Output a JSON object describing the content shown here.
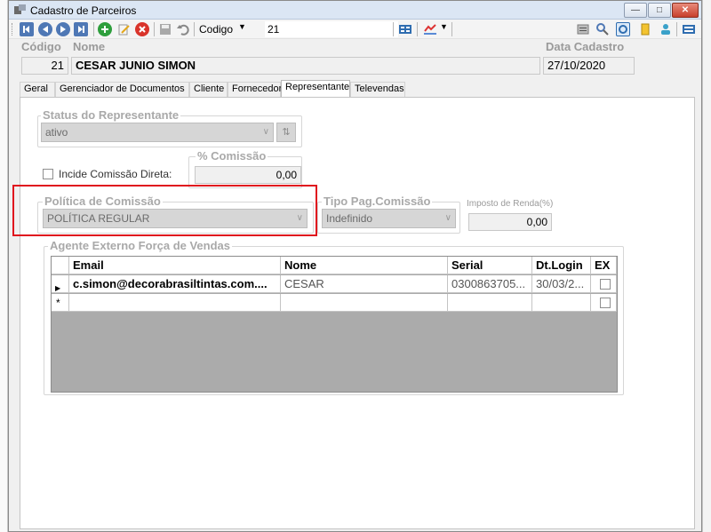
{
  "window": {
    "title": "Cadastro de Parceiros"
  },
  "toolbar": {
    "codigo_label": "Codigo",
    "codigo_value": "21",
    "icons_left": [
      "first-record-icon",
      "previous-record-icon",
      "next-record-icon",
      "last-record-icon",
      "add-icon",
      "edit-icon",
      "delete-icon",
      "save-icon",
      "undo-icon"
    ],
    "icons_right": [
      "grid-view-icon",
      "chart-icon",
      "report-icon",
      "search-icon",
      "refresh-icon",
      "filter-icon",
      "user-icon",
      "layout-icon"
    ]
  },
  "header": {
    "codigo_label": "Código",
    "nome_label": "Nome",
    "data_label": "Data Cadastro",
    "codigo_value": "21",
    "nome_value": "CESAR JUNIO SIMON",
    "data_value": "27/10/2020"
  },
  "tabs": [
    {
      "label": "Geral"
    },
    {
      "label": "Gerenciador de Documentos"
    },
    {
      "label": "Cliente"
    },
    {
      "label": "Fornecedor"
    },
    {
      "label": "Representante"
    },
    {
      "label": "Televendas"
    }
  ],
  "representante": {
    "status_group_label": "Status do Representante",
    "status_value": "ativo",
    "incide_label": "Incide Comissão Direta:",
    "comissao_label": "% Comissão",
    "comissao_value": "0,00",
    "politica_label": "Política de Comissão",
    "politica_value": "POLÍTICA REGULAR",
    "tipo_pag_label": "Tipo Pag.Comissão",
    "tipo_pag_value": "Indefinido",
    "imposto_label": "Imposto de Renda(%)",
    "imposto_value": "0,00",
    "agente_label": "Agente Externo Força de Vendas"
  },
  "grid": {
    "columns": [
      "Email",
      "Nome",
      "Serial",
      "Dt.Login",
      "EX"
    ],
    "rows": [
      {
        "email": "c.simon@decorabrasiltintas.com....",
        "nome": "CESAR",
        "serial": "0300863705...",
        "dtlogin": "30/03/2...",
        "ex": false
      }
    ],
    "new_row_marker": "*"
  }
}
